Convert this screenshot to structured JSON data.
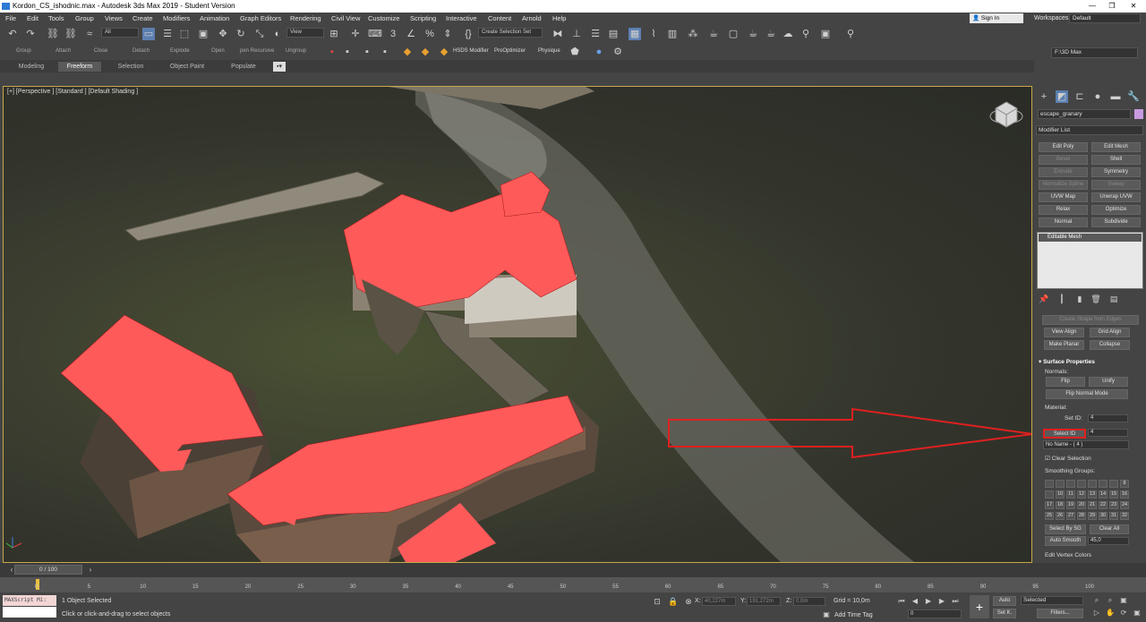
{
  "window": {
    "title": "Kordon_CS_ishodnic.max - Autodesk 3ds Max 2019 - Student Version",
    "controls": [
      "—",
      "❐",
      "✕"
    ]
  },
  "menu": [
    "File",
    "Edit",
    "Tools",
    "Group",
    "Views",
    "Create",
    "Modifiers",
    "Animation",
    "Graph Editors",
    "Rendering",
    "Civil View",
    "Customize",
    "Scripting",
    "Interactive",
    "Content",
    "Arnold",
    "Help"
  ],
  "account": {
    "signin": "Sign In",
    "workspaces_label": "Workspaces:",
    "workspace": "Default"
  },
  "toolbar1": {
    "selection_filter": "All",
    "view": "View",
    "selection_set": "Create Selection Set"
  },
  "toolbar2": {
    "labels": [
      "Group",
      "Attach",
      "Close",
      "Detach",
      "Explode",
      "Open",
      "pen Recursive",
      "Ungroup"
    ],
    "plugins": [
      "HSDS Modifier",
      "ProOptimizer",
      "Physique"
    ],
    "path": "F:\\3D Max"
  },
  "ribbon": {
    "tabs": [
      "Modeling",
      "Freeform",
      "Selection",
      "Object Paint",
      "Populate"
    ],
    "active": "Freeform"
  },
  "viewport": {
    "label": "[+] [Perspective ] [Standard ] [Default Shading ]"
  },
  "command_panel": {
    "object_name": "escape_granary",
    "object_color": "#c89be0",
    "modifier_list": "Modifier List",
    "modifier_buttons": [
      {
        "label": "Edit Poly",
        "enabled": true
      },
      {
        "label": "Edit Mesh",
        "enabled": true
      },
      {
        "label": "Bevel",
        "enabled": false
      },
      {
        "label": "Shell",
        "enabled": true
      },
      {
        "label": "Extrude",
        "enabled": false
      },
      {
        "label": "Symmetry",
        "enabled": true
      },
      {
        "label": "Normalize Spline",
        "enabled": false
      },
      {
        "label": "Sweep",
        "enabled": false
      },
      {
        "label": "UVW Map",
        "enabled": true
      },
      {
        "label": "Unwrap UVW",
        "enabled": true
      },
      {
        "label": "Relax",
        "enabled": true
      },
      {
        "label": "Optimize",
        "enabled": true
      },
      {
        "label": "Normal",
        "enabled": true
      },
      {
        "label": "Subdivide",
        "enabled": true
      }
    ],
    "stack_item": "Editable Mesh",
    "create_shape": "Create Shape from Edges",
    "view_align": "View Align",
    "grid_align": "Grid Align",
    "make_planar": "Make Planar",
    "collapse": "Collapse",
    "surface_properties": "Surface Properties",
    "normals": "Normals:",
    "flip": "Flip",
    "unify": "Unify",
    "flip_normal_mode": "Flip Normal Mode",
    "material": "Material:",
    "set_id_label": "Set ID:",
    "set_id_value": "4",
    "select_id": "Select ID",
    "select_id_value": "4",
    "no_name": "No Name - ( 4 )",
    "clear_selection": "Clear Selection",
    "smoothing_groups": "Smoothing Groups:",
    "sg_numbers": [
      "1",
      "2",
      "3",
      "4",
      "5",
      "6",
      "7",
      "8",
      "9",
      "10",
      "11",
      "12",
      "13",
      "14",
      "15",
      "16",
      "17",
      "18",
      "19",
      "20",
      "21",
      "22",
      "23",
      "24",
      "25",
      "26",
      "27",
      "28",
      "29",
      "30",
      "31",
      "32"
    ],
    "sg_visible": [
      "",
      "",
      "",
      "",
      "",
      "",
      "",
      "8",
      "",
      "10",
      "11",
      "12",
      "13",
      "14",
      "15",
      "16",
      "17",
      "18",
      "19",
      "20",
      "21",
      "22",
      "23",
      "24",
      "25",
      "26",
      "27",
      "28",
      "29",
      "30",
      "31",
      "32"
    ],
    "select_by_sg": "Select By SG",
    "clear_all": "Clear All",
    "auto_smooth": "Auto Smooth",
    "auto_smooth_value": "45,0",
    "edit_vertex_colors": "Edit Vertex Colors"
  },
  "timeline": {
    "frame": "0 / 100",
    "ticks": [
      "0",
      "5",
      "10",
      "15",
      "20",
      "25",
      "30",
      "35",
      "40",
      "45",
      "50",
      "55",
      "60",
      "65",
      "70",
      "75",
      "80",
      "85",
      "90",
      "95",
      "100"
    ]
  },
  "status": {
    "maxscript": "MAXScript Mi:",
    "selected": "1 Object Selected",
    "prompt": "Click or click-and-drag to select objects",
    "x_label": "X:",
    "x_value": "40,227m",
    "y_label": "Y:",
    "y_value": "191,272m",
    "z_label": "Z:",
    "z_value": "0,0m",
    "grid": "Grid = 10,0m",
    "add_time_tag": "Add Time Tag",
    "auto": "Auto",
    "selected_dd": "Selected",
    "set_key": "Set K.",
    "filters": "Filters...",
    "frame_field": "0"
  },
  "colors": {
    "highlight": "#ff5a5a",
    "annotation": "#e02020",
    "viewport_border": "#c8a84a"
  }
}
